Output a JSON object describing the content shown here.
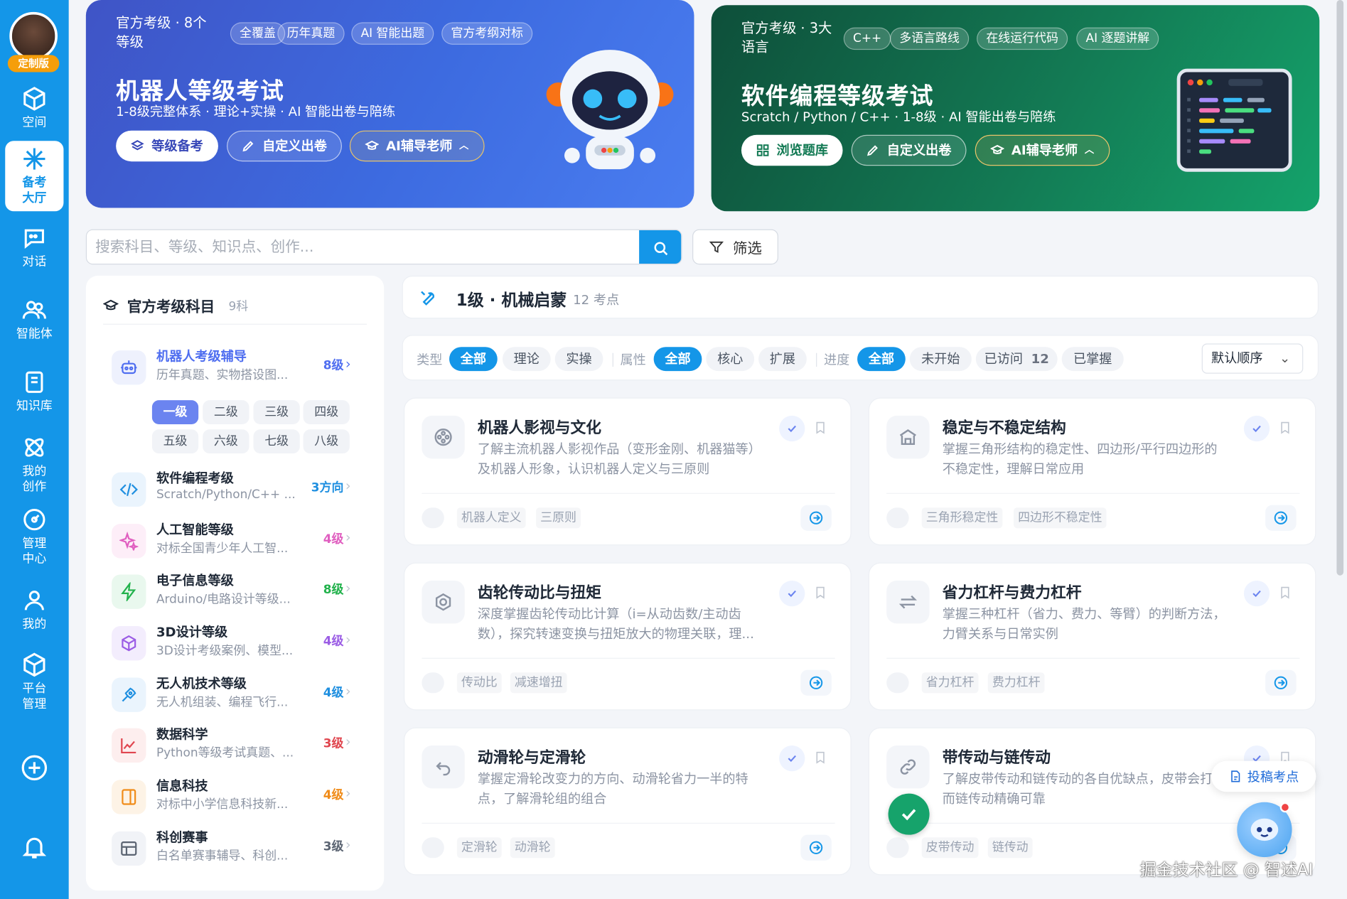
{
  "sidebar": {
    "badge": "定制版",
    "items": [
      {
        "label": "空间",
        "icon": "cube-icon"
      },
      {
        "label": "备考大厅",
        "icon": "sparkle-icon",
        "active": true
      },
      {
        "label": "对话",
        "icon": "chat-icon"
      },
      {
        "label": "智能体",
        "icon": "users-icon"
      },
      {
        "label": "知识库",
        "icon": "book-icon"
      },
      {
        "label": "我的创作",
        "icon": "atom-icon"
      },
      {
        "label": "管理中心",
        "icon": "gauge-icon"
      },
      {
        "label": "我的",
        "icon": "user-icon"
      },
      {
        "label": "平台管理",
        "icon": "box-icon"
      }
    ],
    "add_icon": "plus-circle-icon",
    "bell_icon": "bell-icon"
  },
  "banner1": {
    "sub": "官方考级 · 8个等级",
    "chips": [
      "全覆盖",
      "历年真题",
      "AI 智能出题",
      "官方考纲对标"
    ],
    "title": "机器人等级考试",
    "desc": "1-8级完整体系 · 理论+实操 · AI 智能出卷与陪练",
    "buttons": [
      "等级备考",
      "自定义出卷",
      "AI辅导老师"
    ]
  },
  "banner2": {
    "sub": "官方考级 · 3大语言",
    "chips": [
      "C++",
      "多语言路线",
      "在线运行代码",
      "AI 逐题讲解"
    ],
    "title": "软件编程等级考试",
    "desc": "Scratch / Python / C++ · 1-8级 · AI 智能出卷与陪练",
    "buttons": [
      "浏览题库",
      "自定义出卷",
      "AI辅导老师"
    ]
  },
  "search": {
    "placeholder": "搜索科目、等级、知识点、创作..."
  },
  "filter_label": "筛选",
  "left_panel": {
    "title": "官方考级科目",
    "count": "9科",
    "subjects": [
      {
        "name": "机器人考级辅导",
        "desc": "历年真题、实物搭设图...",
        "level": "8级",
        "color": "#4f6ef0"
      },
      {
        "name": "软件编程考级",
        "desc": "Scratch/Python/C++ ...",
        "level": "3方向",
        "color": "#1f8fe0"
      },
      {
        "name": "人工智能等级",
        "desc": "对标全国青少年人工智...",
        "level": "4级",
        "color": "#e05fc0"
      },
      {
        "name": "电子信息等级",
        "desc": "Arduino/电路设计等级...",
        "level": "8级",
        "color": "#22b24c"
      },
      {
        "name": "3D设计等级",
        "desc": "3D设计考级案例、模型...",
        "level": "4级",
        "color": "#9b5de5"
      },
      {
        "name": "无人机技术等级",
        "desc": "无人机组装、编程飞行...",
        "level": "4级",
        "color": "#1f8fe0"
      },
      {
        "name": "数据科学",
        "desc": "Python等级考试真题、...",
        "level": "3级",
        "color": "#e0464f"
      },
      {
        "name": "信息科技",
        "desc": "对标中小学信息科技新...",
        "level": "4级",
        "color": "#f08c1a"
      },
      {
        "name": "科创赛事",
        "desc": "白名单赛事辅导、科创...",
        "level": "3级",
        "color": "#5b6472"
      }
    ],
    "levels": [
      "一级",
      "二级",
      "三级",
      "四级",
      "五级",
      "六级",
      "七级",
      "八级"
    ]
  },
  "section": {
    "title": "1级 · 机械启蒙",
    "count": "12 考点"
  },
  "filters": {
    "type_label": "类型",
    "type_opts": [
      "全部",
      "理论",
      "实操"
    ],
    "attr_label": "属性",
    "attr_opts": [
      "全部",
      "核心",
      "扩展"
    ],
    "prog_label": "进度",
    "prog_opts": [
      "全部",
      "未开始",
      "已访问",
      "已掌握"
    ],
    "visited_count": "12",
    "sort": "默认顺序"
  },
  "cards": [
    {
      "title": "机器人影视与文化",
      "desc": "了解主流机器人影视作品（变形金刚、机器猫等）及机器人形象，认识机器人定义与三原则",
      "tags": [
        "机器人定义",
        "三原则"
      ]
    },
    {
      "title": "稳定与不稳定结构",
      "desc": "掌握三角形结构的稳定性、四边形/平行四边形的不稳定性，理解日常应用",
      "tags": [
        "三角形稳定性",
        "四边形不稳定性"
      ]
    },
    {
      "title": "齿轮传动比与扭矩",
      "desc": "深度掌握齿轮传动比计算（i=从动齿数/主动齿数），探究转速变换与扭矩放大的物理关联，理...",
      "tags": [
        "传动比",
        "减速增扭"
      ]
    },
    {
      "title": "省力杠杆与费力杠杆",
      "desc": "掌握三种杠杆（省力、费力、等臂）的判断方法，力臂关系与日常实例",
      "tags": [
        "省力杠杆",
        "费力杠杆"
      ]
    },
    {
      "title": "动滑轮与定滑轮",
      "desc": "掌握定滑轮改变力的方向、动滑轮省力一半的特点，了解滑轮组的组合",
      "tags": [
        "定滑轮",
        "动滑轮"
      ]
    },
    {
      "title": "带传动与链传动",
      "desc": "了解皮带传动和链传动的各自优缺点，皮带会打滑而链传动精确可靠",
      "tags": [
        "皮带传动",
        "链传动"
      ]
    }
  ],
  "submit_label": "投稿考点",
  "watermark": "掘金技术社区 @ 智述AI"
}
